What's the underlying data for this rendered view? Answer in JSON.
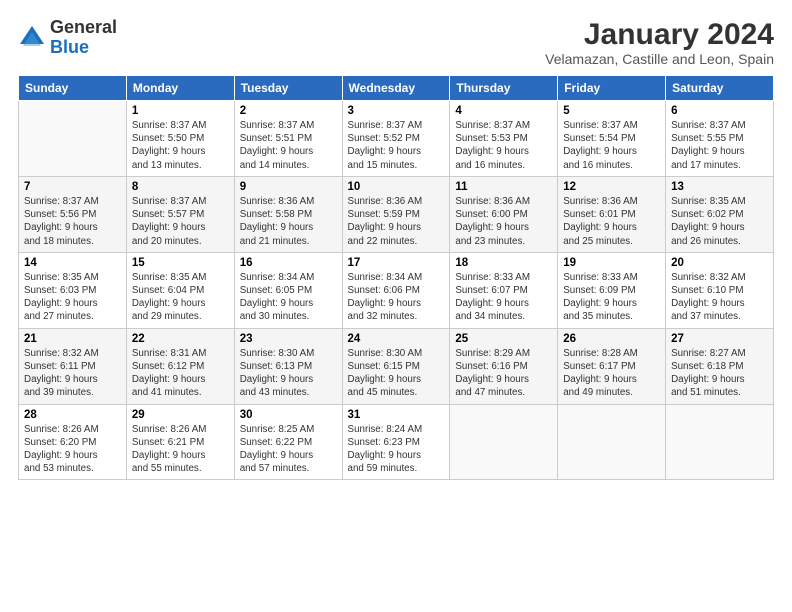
{
  "logo": {
    "general": "General",
    "blue": "Blue"
  },
  "title": "January 2024",
  "subtitle": "Velamazan, Castille and Leon, Spain",
  "weekdays": [
    "Sunday",
    "Monday",
    "Tuesday",
    "Wednesday",
    "Thursday",
    "Friday",
    "Saturday"
  ],
  "weeks": [
    [
      {
        "day": "",
        "info": ""
      },
      {
        "day": "1",
        "info": "Sunrise: 8:37 AM\nSunset: 5:50 PM\nDaylight: 9 hours\nand 13 minutes."
      },
      {
        "day": "2",
        "info": "Sunrise: 8:37 AM\nSunset: 5:51 PM\nDaylight: 9 hours\nand 14 minutes."
      },
      {
        "day": "3",
        "info": "Sunrise: 8:37 AM\nSunset: 5:52 PM\nDaylight: 9 hours\nand 15 minutes."
      },
      {
        "day": "4",
        "info": "Sunrise: 8:37 AM\nSunset: 5:53 PM\nDaylight: 9 hours\nand 16 minutes."
      },
      {
        "day": "5",
        "info": "Sunrise: 8:37 AM\nSunset: 5:54 PM\nDaylight: 9 hours\nand 16 minutes."
      },
      {
        "day": "6",
        "info": "Sunrise: 8:37 AM\nSunset: 5:55 PM\nDaylight: 9 hours\nand 17 minutes."
      }
    ],
    [
      {
        "day": "7",
        "info": "Sunrise: 8:37 AM\nSunset: 5:56 PM\nDaylight: 9 hours\nand 18 minutes."
      },
      {
        "day": "8",
        "info": "Sunrise: 8:37 AM\nSunset: 5:57 PM\nDaylight: 9 hours\nand 20 minutes."
      },
      {
        "day": "9",
        "info": "Sunrise: 8:36 AM\nSunset: 5:58 PM\nDaylight: 9 hours\nand 21 minutes."
      },
      {
        "day": "10",
        "info": "Sunrise: 8:36 AM\nSunset: 5:59 PM\nDaylight: 9 hours\nand 22 minutes."
      },
      {
        "day": "11",
        "info": "Sunrise: 8:36 AM\nSunset: 6:00 PM\nDaylight: 9 hours\nand 23 minutes."
      },
      {
        "day": "12",
        "info": "Sunrise: 8:36 AM\nSunset: 6:01 PM\nDaylight: 9 hours\nand 25 minutes."
      },
      {
        "day": "13",
        "info": "Sunrise: 8:35 AM\nSunset: 6:02 PM\nDaylight: 9 hours\nand 26 minutes."
      }
    ],
    [
      {
        "day": "14",
        "info": "Sunrise: 8:35 AM\nSunset: 6:03 PM\nDaylight: 9 hours\nand 27 minutes."
      },
      {
        "day": "15",
        "info": "Sunrise: 8:35 AM\nSunset: 6:04 PM\nDaylight: 9 hours\nand 29 minutes."
      },
      {
        "day": "16",
        "info": "Sunrise: 8:34 AM\nSunset: 6:05 PM\nDaylight: 9 hours\nand 30 minutes."
      },
      {
        "day": "17",
        "info": "Sunrise: 8:34 AM\nSunset: 6:06 PM\nDaylight: 9 hours\nand 32 minutes."
      },
      {
        "day": "18",
        "info": "Sunrise: 8:33 AM\nSunset: 6:07 PM\nDaylight: 9 hours\nand 34 minutes."
      },
      {
        "day": "19",
        "info": "Sunrise: 8:33 AM\nSunset: 6:09 PM\nDaylight: 9 hours\nand 35 minutes."
      },
      {
        "day": "20",
        "info": "Sunrise: 8:32 AM\nSunset: 6:10 PM\nDaylight: 9 hours\nand 37 minutes."
      }
    ],
    [
      {
        "day": "21",
        "info": "Sunrise: 8:32 AM\nSunset: 6:11 PM\nDaylight: 9 hours\nand 39 minutes."
      },
      {
        "day": "22",
        "info": "Sunrise: 8:31 AM\nSunset: 6:12 PM\nDaylight: 9 hours\nand 41 minutes."
      },
      {
        "day": "23",
        "info": "Sunrise: 8:30 AM\nSunset: 6:13 PM\nDaylight: 9 hours\nand 43 minutes."
      },
      {
        "day": "24",
        "info": "Sunrise: 8:30 AM\nSunset: 6:15 PM\nDaylight: 9 hours\nand 45 minutes."
      },
      {
        "day": "25",
        "info": "Sunrise: 8:29 AM\nSunset: 6:16 PM\nDaylight: 9 hours\nand 47 minutes."
      },
      {
        "day": "26",
        "info": "Sunrise: 8:28 AM\nSunset: 6:17 PM\nDaylight: 9 hours\nand 49 minutes."
      },
      {
        "day": "27",
        "info": "Sunrise: 8:27 AM\nSunset: 6:18 PM\nDaylight: 9 hours\nand 51 minutes."
      }
    ],
    [
      {
        "day": "28",
        "info": "Sunrise: 8:26 AM\nSunset: 6:20 PM\nDaylight: 9 hours\nand 53 minutes."
      },
      {
        "day": "29",
        "info": "Sunrise: 8:26 AM\nSunset: 6:21 PM\nDaylight: 9 hours\nand 55 minutes."
      },
      {
        "day": "30",
        "info": "Sunrise: 8:25 AM\nSunset: 6:22 PM\nDaylight: 9 hours\nand 57 minutes."
      },
      {
        "day": "31",
        "info": "Sunrise: 8:24 AM\nSunset: 6:23 PM\nDaylight: 9 hours\nand 59 minutes."
      },
      {
        "day": "",
        "info": ""
      },
      {
        "day": "",
        "info": ""
      },
      {
        "day": "",
        "info": ""
      }
    ]
  ]
}
